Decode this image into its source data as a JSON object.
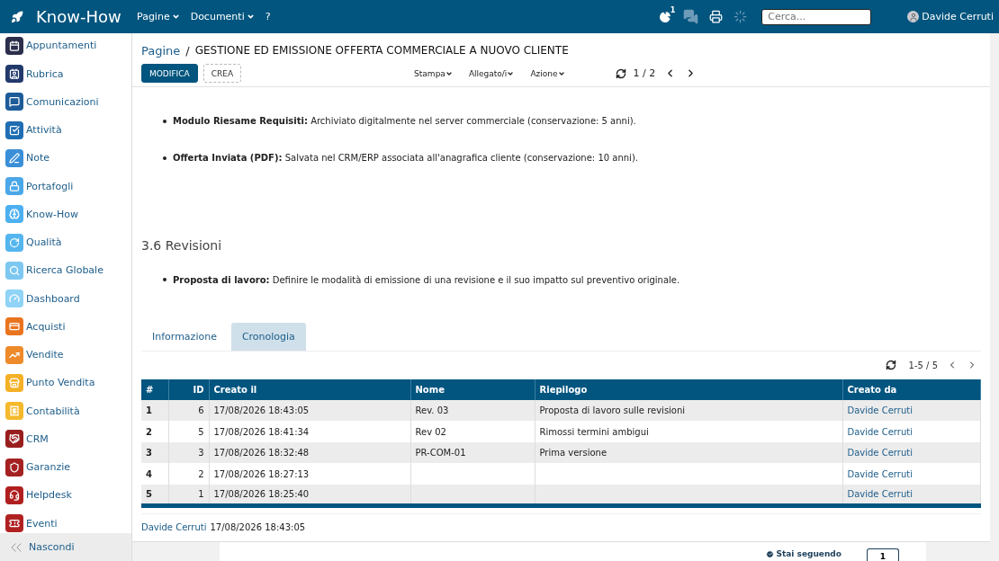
{
  "topbar": {
    "app_title": "Know-How",
    "menus": [
      {
        "label": "Pagine",
        "kind": "dropdown"
      },
      {
        "label": "Documenti",
        "kind": "dropdown"
      },
      {
        "label": "?",
        "kind": "link"
      }
    ],
    "notification_count": "1",
    "search": {
      "placeholder": "Cerca..."
    },
    "user": "Davide Cerruti"
  },
  "sidebar": {
    "items": [
      {
        "label": "Appuntamenti",
        "color": "#2b2f4c"
      },
      {
        "label": "Rubrica",
        "color": "#22396c"
      },
      {
        "label": "Comunicazioni",
        "color": "#1d5c99"
      },
      {
        "label": "Attività",
        "color": "#1f6db2"
      },
      {
        "label": "Note",
        "color": "#3a8fd8"
      },
      {
        "label": "Portafogli",
        "color": "#4aa7e8"
      },
      {
        "label": "Know-How",
        "color": "#4caff0"
      },
      {
        "label": "Qualità",
        "color": "#55b6ef"
      },
      {
        "label": "Ricerca Globale",
        "color": "#7dc8f0"
      },
      {
        "label": "Dashboard",
        "color": "#8fd3f6"
      },
      {
        "label": "Acquisti",
        "color": "#e9741f"
      },
      {
        "label": "Vendite",
        "color": "#ee8a2a"
      },
      {
        "label": "Punto Vendita",
        "color": "#f4b026"
      },
      {
        "label": "Contabilità",
        "color": "#f5b92c"
      },
      {
        "label": "CRM",
        "color": "#981e1e"
      },
      {
        "label": "Garanzie",
        "color": "#a52121"
      },
      {
        "label": "Helpdesk",
        "color": "#b01f1f"
      },
      {
        "label": "Eventi",
        "color": "#b02222"
      }
    ],
    "hide_label": "Nascondi"
  },
  "breadcrumb": {
    "parent": "Pagine",
    "separator": "/",
    "title": "GESTIONE ED EMISSIONE OFFERTA COMMERCIALE A NUOVO CLIENTE"
  },
  "toolbar": {
    "buttons": [
      {
        "label": "MODIFICA",
        "primary": true
      },
      {
        "label": "CREA",
        "primary": false
      }
    ],
    "menus": [
      "Stampa",
      "Allegato/i",
      "Azione"
    ],
    "page": "1 / 2"
  },
  "content": [
    {
      "kind": "bullet",
      "text": "**Modulo Riesame Requisiti:** Archiviato digitalmente nel server commerciale (conservazione: 5 anni)."
    },
    {
      "kind": "bullet",
      "text": "**Offerta Inviata (PDF):** Salvata nel CRM/ERP associata all'anagrafica cliente (conservazione: 10 anni)."
    },
    {
      "kind": "heading",
      "text": "3.6 Revisioni"
    },
    {
      "kind": "bullet",
      "text": "**Proposta di lavoro:** Definire le modalità di emissione di una revisione e il suo impatto sul preventivo originale."
    }
  ],
  "tabs": [
    {
      "label": "Informazione",
      "selected": false
    },
    {
      "label": "Cronologia",
      "selected": true
    }
  ],
  "history": {
    "range": "1-5 / 5",
    "columns": [
      "#",
      "ID",
      "Creato il",
      "Nome",
      "Riepilogo",
      "Creato da"
    ],
    "rows": [
      [
        "1",
        "6",
        "17/08/2026 18:43:05",
        "Rev. 03",
        "Proposta di lavoro sulle revisioni",
        "Davide Cerruti"
      ],
      [
        "2",
        "5",
        "17/08/2026 18:41:34",
        "Rev 02",
        "Rimossi termini ambigui",
        "Davide Cerruti"
      ],
      [
        "3",
        "3",
        "17/08/2026 18:32:48",
        "PR-COM-01",
        "Prima versione",
        "Davide Cerruti"
      ],
      [
        "4",
        "2",
        "17/08/2026 18:27:13",
        "",
        "",
        "Davide Cerruti"
      ],
      [
        "5",
        "1",
        "17/08/2026 18:25:40",
        "",
        "",
        "Davide Cerruti"
      ]
    ]
  },
  "footer": {
    "author": "Davide Cerruti",
    "date": "17/08/2026 18:43:05"
  },
  "follow": {
    "label": "Stai seguendo",
    "count": "1"
  }
}
